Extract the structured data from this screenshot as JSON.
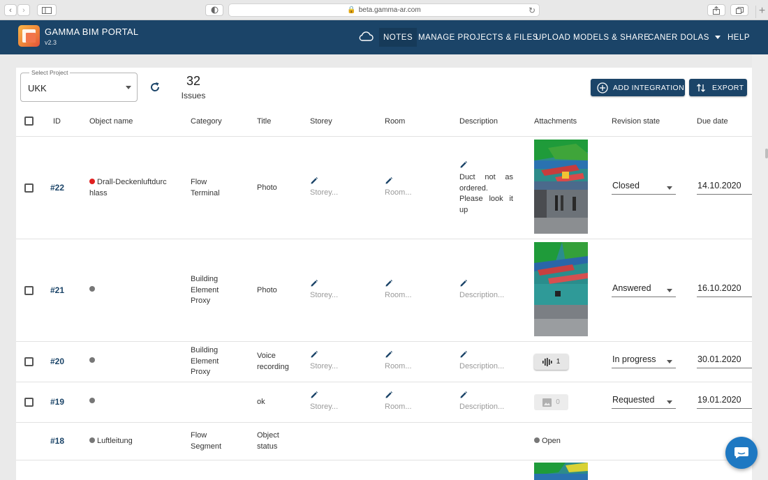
{
  "browser": {
    "url": "beta.gamma-ar.com"
  },
  "app": {
    "title": "GAMMA BIM PORTAL",
    "version": "v2.3",
    "nav": [
      "NOTES",
      "MANAGE PROJECTS & FILES",
      "UPLOAD MODELS & SHARE",
      "CANER DOLAS",
      "HELP"
    ],
    "active_nav": "NOTES",
    "colors": {
      "header": "#1b4468",
      "accent_link": "#1b4468",
      "chat_button": "#1e78c2"
    }
  },
  "toolbar": {
    "project_legend": "Select Project",
    "project_value": "UKK",
    "issues_count": "32",
    "issues_label": "Issues",
    "add_integration": "ADD INTEGRATION",
    "export": "EXPORT"
  },
  "table": {
    "headers": [
      "ID",
      "Object name",
      "Category",
      "Title",
      "Storey",
      "Room",
      "Description",
      "Attachments",
      "Revision state",
      "Due date"
    ],
    "placeholders": {
      "storey": "Storey...",
      "room": "Room...",
      "description": "Description..."
    },
    "rows": [
      {
        "id": "#22",
        "status_color": "#e02020",
        "object_lines": [
          "Drall-Deckenluftdurc",
          "hlass"
        ],
        "category_lines": [
          "Flow",
          "Terminal"
        ],
        "title_lines": [
          "Photo"
        ],
        "description_lines": [
          "Duct not as",
          "ordered.",
          "Please look it",
          "up"
        ],
        "revision": "Closed",
        "due": "14.10.2020"
      },
      {
        "id": "#21",
        "status_color": "#777777",
        "object_lines": [],
        "category_lines": [
          "Building",
          "Element",
          "Proxy"
        ],
        "title_lines": [
          "Photo"
        ],
        "revision": "Answered",
        "due": "16.10.2020"
      },
      {
        "id": "#20",
        "status_color": "#777777",
        "object_lines": [],
        "category_lines": [
          "Building",
          "Element",
          "Proxy"
        ],
        "title_lines": [
          "Voice",
          "recording"
        ],
        "attachment": {
          "icon": "audio-wave-icon",
          "count": "1"
        },
        "revision": "In progress",
        "due": "30.01.2020"
      },
      {
        "id": "#19",
        "status_color": "#777777",
        "object_lines": [],
        "category_lines": [],
        "title_lines": [
          "ok"
        ],
        "attachment": {
          "icon": "image-icon",
          "count": "0"
        },
        "revision": "Requested",
        "due": "19.01.2020"
      },
      {
        "id": "#18",
        "status_color": "#777777",
        "object_lines": [
          "Luftleitung"
        ],
        "category_lines": [
          "Flow",
          "Segment"
        ],
        "title_lines": [
          "Object",
          "status"
        ],
        "attachment_status": "Open"
      }
    ]
  }
}
